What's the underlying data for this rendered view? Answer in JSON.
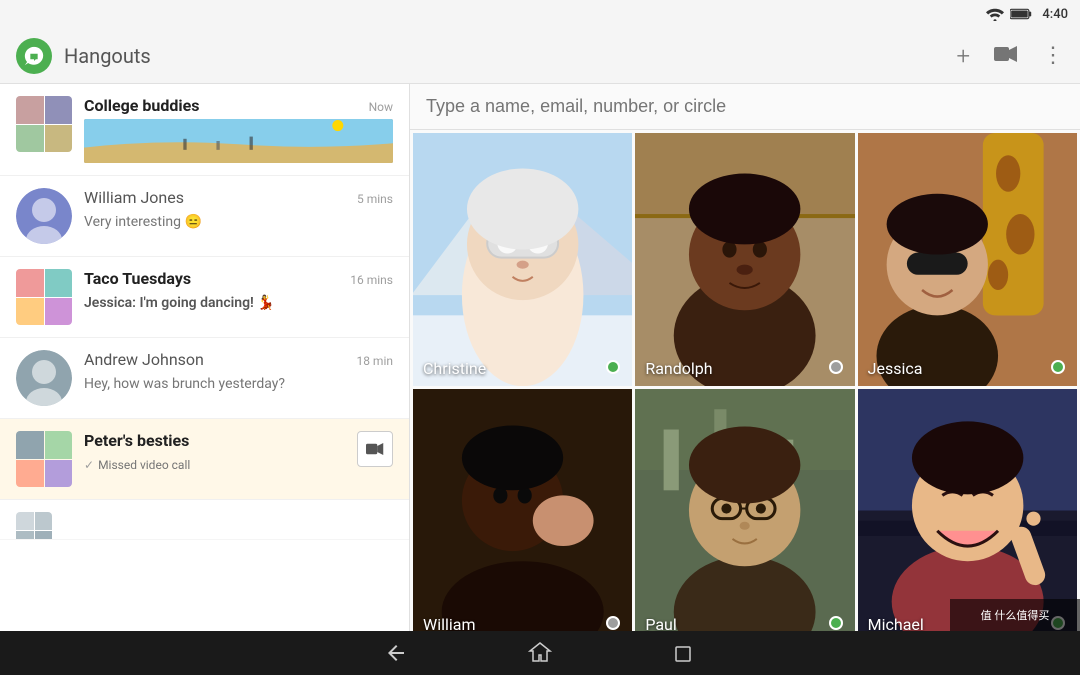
{
  "statusBar": {
    "time": "4:40",
    "wifiIcon": "wifi",
    "batteryIcon": "battery"
  },
  "toolbar": {
    "title": "Hangouts",
    "addLabel": "+",
    "videoLabel": "📹",
    "moreLabel": "⋮"
  },
  "search": {
    "placeholder": "Type a name, email, number, or circle"
  },
  "conversations": [
    {
      "id": "college-buddies",
      "name": "College buddies",
      "time": "Now",
      "preview": "",
      "hasPreviewImage": true,
      "bold": true,
      "avatarType": "group"
    },
    {
      "id": "william-jones",
      "name": "William Jones",
      "time": "5 mins",
      "preview": "Very interesting 😑",
      "bold": false,
      "avatarType": "person"
    },
    {
      "id": "taco-tuesdays",
      "name": "Taco Tuesdays",
      "time": "16 mins",
      "preview": "Jessica: I'm going dancing! 💃",
      "bold": true,
      "avatarType": "group"
    },
    {
      "id": "andrew-johnson",
      "name": "Andrew Johnson",
      "time": "18 min",
      "preview": "Hey, how was brunch yesterday?",
      "bold": false,
      "avatarType": "person"
    },
    {
      "id": "peters-besties",
      "name": "Peter's besties",
      "time": "",
      "preview": "Missed video call",
      "missedCall": true,
      "bold": true,
      "avatarType": "group"
    },
    {
      "id": "partial",
      "name": "...",
      "partial": true
    }
  ],
  "contacts": [
    {
      "id": "christine",
      "name": "Christine",
      "online": true,
      "onlineColor": "green"
    },
    {
      "id": "randolph",
      "name": "Randolph",
      "online": true,
      "onlineColor": "gray"
    },
    {
      "id": "jessica",
      "name": "Jessica",
      "online": true,
      "onlineColor": "green"
    },
    {
      "id": "william",
      "name": "William",
      "online": true,
      "onlineColor": "gray"
    },
    {
      "id": "paul",
      "name": "Paul",
      "online": true,
      "onlineColor": "green"
    },
    {
      "id": "michael",
      "name": "Michael",
      "online": true,
      "onlineColor": "green"
    }
  ],
  "navbar": {
    "backLabel": "←",
    "homeLabel": "⌂",
    "recentLabel": "▭"
  },
  "watermark": {
    "text": "值 什么值得买"
  }
}
